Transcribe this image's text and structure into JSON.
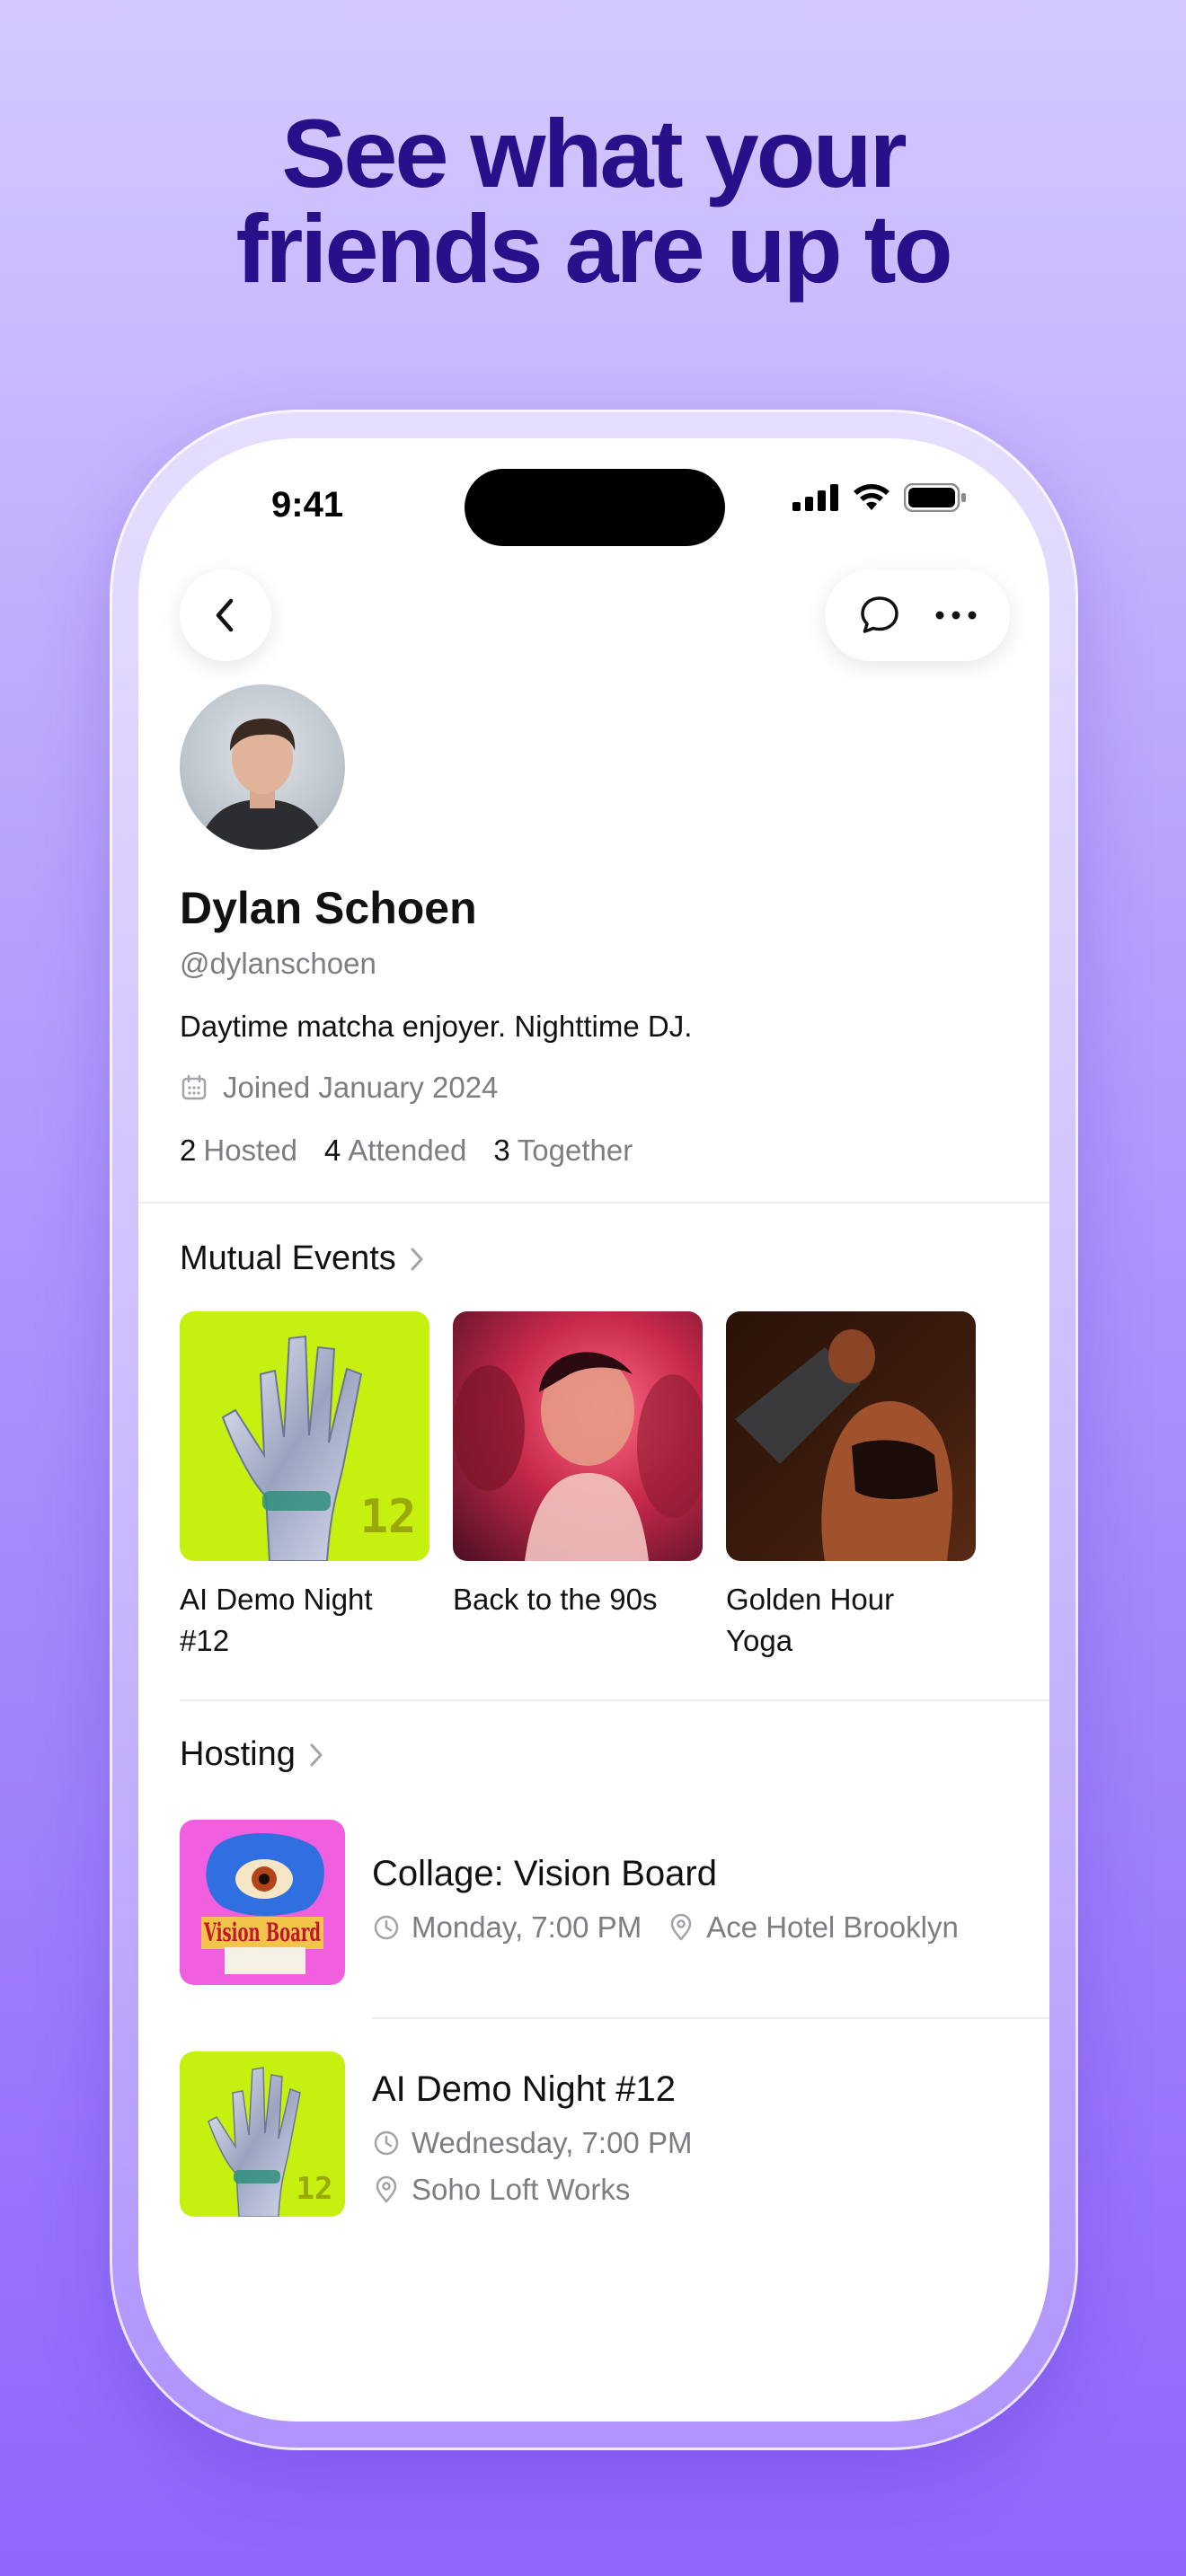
{
  "headline": {
    "line1": "See what your",
    "line2": "friends are up to"
  },
  "status_bar": {
    "time": "9:41"
  },
  "profile": {
    "name": "Dylan Schoen",
    "handle": "@dylanschoen",
    "bio": "Daytime matcha enjoyer. Nighttime DJ.",
    "joined": "Joined January 2024",
    "stats": [
      {
        "count": "2",
        "label": "Hosted"
      },
      {
        "count": "4",
        "label": "Attended"
      },
      {
        "count": "3",
        "label": "Together"
      }
    ]
  },
  "mutual_events": {
    "title": "Mutual Events",
    "items": [
      {
        "label": "AI Demo Night #12",
        "thumb_badge": "12"
      },
      {
        "label": "Back to the 90s"
      },
      {
        "label": "Golden Hour Yoga"
      }
    ]
  },
  "hosting": {
    "title": "Hosting",
    "items": [
      {
        "title": "Collage: Vision Board",
        "time": "Monday, 7:00 PM",
        "location": "Ace Hotel Brooklyn",
        "thumb_text": "Vision Board"
      },
      {
        "title": "AI Demo Night #12",
        "time": "Wednesday, 7:00 PM",
        "location": "Soho Loft Works",
        "thumb_badge": "12"
      }
    ]
  },
  "colors": {
    "accent": "#2a0f8a",
    "lime": "#c6f00f",
    "muted": "#7d7d82"
  }
}
